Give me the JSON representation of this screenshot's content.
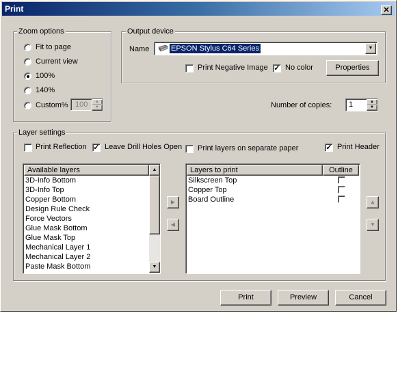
{
  "window": {
    "title": "Print",
    "close_glyph": "✕"
  },
  "zoom_options": {
    "legend": "Zoom options",
    "options": [
      "Fit to page",
      "Current view",
      "100%",
      "140%",
      "Custom%"
    ],
    "selected": "100%",
    "custom_value": "100"
  },
  "output_device": {
    "legend": "Output device",
    "name_label": "Name",
    "printer": "EPSON Stylus C64 Series",
    "print_negative_label": "Print Negative Image",
    "print_negative_checked": false,
    "no_color_label": "No color",
    "no_color_checked": true,
    "properties_label": "Properties"
  },
  "copies": {
    "label": "Number of copies:",
    "value": "1"
  },
  "layer_settings": {
    "legend": "Layer settings",
    "print_reflection_label": "Print Reflection",
    "print_reflection_checked": false,
    "leave_drill_holes_label": "Leave Drill Holes Open",
    "leave_drill_holes_checked": true,
    "separate_paper_label": "Print layers on separate paper",
    "separate_paper_checked": false,
    "print_header_label": "Print Header",
    "print_header_checked": true
  },
  "available_layers": {
    "header": "Available layers",
    "items": [
      "3D-Info Bottom",
      "3D-Info Top",
      "Copper Bottom",
      "Design Rule Check",
      "Force Vectors",
      "Glue Mask Bottom",
      "Glue Mask Top",
      "Mechanical Layer 1",
      "Mechanical Layer 2",
      "Paste Mask Bottom"
    ]
  },
  "layers_to_print": {
    "header": "Layers to print",
    "outline_header": "Outline",
    "items": [
      {
        "name": "Silkscreen Top",
        "outline": false
      },
      {
        "name": "Copper Top",
        "outline": false
      },
      {
        "name": "Board Outline",
        "outline": false
      }
    ]
  },
  "buttons": {
    "print": "Print",
    "preview": "Preview",
    "cancel": "Cancel"
  },
  "glyphs": {
    "check": "✓",
    "up": "▲",
    "down": "▼",
    "right": "▶",
    "left": "◀"
  }
}
